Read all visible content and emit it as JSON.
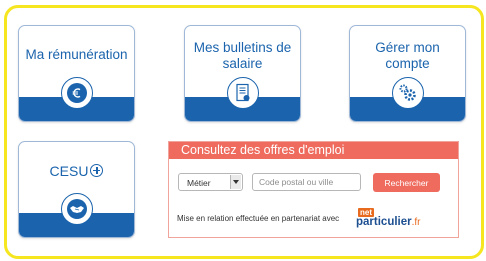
{
  "tiles": [
    {
      "title": "Ma rémunération",
      "icon": "euro-icon"
    },
    {
      "title": "Mes bulletins de salaire",
      "icon": "payslip-icon"
    },
    {
      "title": "Gérer mon compte",
      "icon": "gears-icon"
    },
    {
      "title": "CESU",
      "icon": "handshake-icon"
    }
  ],
  "jobs": {
    "header": "Consultez des offres d'emploi",
    "select_value": "Métier",
    "postal_placeholder": "Code postal ou ville",
    "search_label": "Rechercher",
    "partner_text": "Mise en relation effectuée en partenariat avec",
    "logo_net": "net",
    "logo_particulier": "particulier",
    "logo_fr": ".fr"
  },
  "colors": {
    "frame": "#f6e61f",
    "brand_blue": "#1b64ad",
    "jobs_accent": "#ee6b5e",
    "logo_orange": "#e86a1e"
  }
}
